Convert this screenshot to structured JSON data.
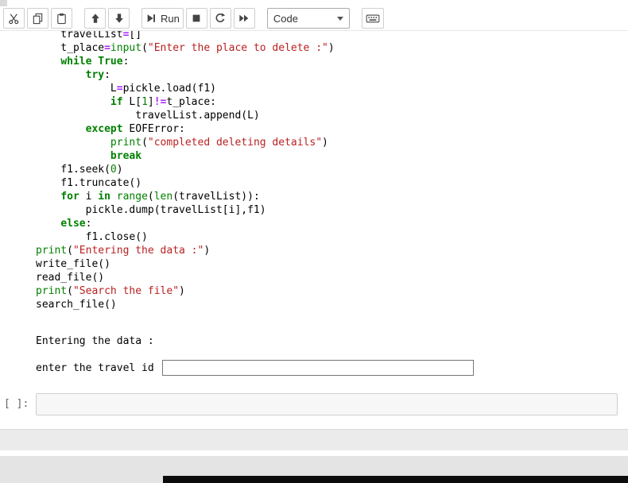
{
  "toolbar": {
    "run_label": "Run",
    "cell_type_value": "Code",
    "icons": [
      "cut-icon",
      "copy-icon",
      "paste-icon",
      "move-up-icon",
      "move-down-icon",
      "run-icon",
      "stop-icon",
      "restart-icon",
      "fast-forward-icon",
      "keyboard-icon"
    ]
  },
  "colors": {
    "keyword": "#008000",
    "builtin": "#008000",
    "string": "#BA2121",
    "number": "#088000",
    "operator": "#AA22FF",
    "prompt": "#616161"
  },
  "code_cell": {
    "lines": [
      [
        [
          "t",
          "    travelList"
        ],
        [
          "o",
          "="
        ],
        [
          "t",
          "[]"
        ]
      ],
      [
        [
          "t",
          "    t_place"
        ],
        [
          "o",
          "="
        ],
        [
          "b",
          "input"
        ],
        [
          "t",
          "("
        ],
        [
          "s",
          "\"Enter the place to delete :\""
        ],
        [
          "t",
          ")"
        ]
      ],
      [
        [
          "t",
          "    "
        ],
        [
          "k",
          "while"
        ],
        [
          "t",
          " "
        ],
        [
          "k",
          "True"
        ],
        [
          "t",
          ":"
        ]
      ],
      [
        [
          "t",
          "        "
        ],
        [
          "k",
          "try"
        ],
        [
          "t",
          ":"
        ]
      ],
      [
        [
          "t",
          "            L"
        ],
        [
          "o",
          "="
        ],
        [
          "t",
          "pickle.load(f1)"
        ]
      ],
      [
        [
          "t",
          "            "
        ],
        [
          "k",
          "if"
        ],
        [
          "t",
          " L["
        ],
        [
          "n",
          "1"
        ],
        [
          "t",
          "]"
        ],
        [
          "o",
          "!="
        ],
        [
          "t",
          "t_place:"
        ]
      ],
      [
        [
          "t",
          "                travelList.append(L)"
        ]
      ],
      [
        [
          "t",
          "        "
        ],
        [
          "k",
          "except"
        ],
        [
          "t",
          " EOFError:"
        ]
      ],
      [
        [
          "t",
          "            "
        ],
        [
          "b",
          "print"
        ],
        [
          "t",
          "("
        ],
        [
          "s",
          "\"completed deleting details\""
        ],
        [
          "t",
          ")"
        ]
      ],
      [
        [
          "t",
          "            "
        ],
        [
          "k",
          "break"
        ]
      ],
      [
        [
          "t",
          "    f1.seek("
        ],
        [
          "n",
          "0"
        ],
        [
          "t",
          ")"
        ]
      ],
      [
        [
          "t",
          "    f1.truncate()"
        ]
      ],
      [
        [
          "t",
          "    "
        ],
        [
          "k",
          "for"
        ],
        [
          "t",
          " i "
        ],
        [
          "k",
          "in"
        ],
        [
          "t",
          " "
        ],
        [
          "b",
          "range"
        ],
        [
          "t",
          "("
        ],
        [
          "b",
          "len"
        ],
        [
          "t",
          "(travelList)):"
        ]
      ],
      [
        [
          "t",
          "        pickle.dump(travelList[i],f1)"
        ]
      ],
      [
        [
          "t",
          "    "
        ],
        [
          "k",
          "else"
        ],
        [
          "t",
          ":"
        ]
      ],
      [
        [
          "t",
          "        f1.close()"
        ]
      ],
      [
        [
          "b",
          "print"
        ],
        [
          "t",
          "("
        ],
        [
          "s",
          "\"Entering the data :\""
        ],
        [
          "t",
          ")"
        ]
      ],
      [
        [
          "t",
          "write_file()"
        ]
      ],
      [
        [
          "t",
          "read_file()"
        ]
      ],
      [
        [
          "b",
          "print"
        ],
        [
          "t",
          "("
        ],
        [
          "s",
          "\"Search the file\""
        ],
        [
          "t",
          ")"
        ]
      ],
      [
        [
          "t",
          "search_file()"
        ]
      ]
    ]
  },
  "output": {
    "text_line": "Entering the data :",
    "stdin_prompt": "enter the travel id ",
    "stdin_value": ""
  },
  "next_cell": {
    "prompt": "[ ]:"
  }
}
